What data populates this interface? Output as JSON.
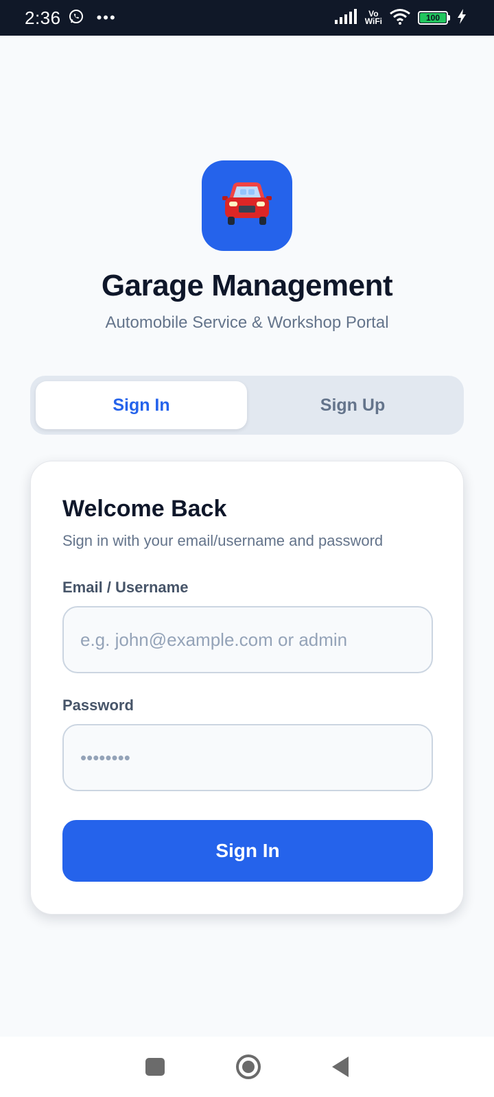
{
  "status_bar": {
    "time": "2:36",
    "notification_icons": [
      "whatsapp-icon",
      "more-dots-icon"
    ],
    "network_label_top": "Vo",
    "network_label_bottom": "WiFi",
    "battery_level": "100",
    "charging": true
  },
  "header": {
    "logo_icon": "car-icon",
    "title": "Garage Management",
    "subtitle": "Automobile Service & Workshop Portal"
  },
  "tabs": [
    {
      "label": "Sign In",
      "active": true
    },
    {
      "label": "Sign Up",
      "active": false
    }
  ],
  "form": {
    "title": "Welcome Back",
    "subtitle": "Sign in with your email/username and password",
    "email_label": "Email / Username",
    "email_placeholder": "e.g. john@example.com or admin",
    "email_value": "",
    "password_label": "Password",
    "password_placeholder": "••••••••",
    "password_value": "",
    "submit_label": "Sign In"
  },
  "nav_bar": {
    "buttons": [
      "recents-square-icon",
      "home-circle-icon",
      "back-triangle-icon"
    ]
  },
  "colors": {
    "primary": "#2563eb",
    "status_bar_bg": "#101828",
    "page_bg": "#f8fafc",
    "title_text": "#0f172a",
    "muted_text": "#64748b"
  }
}
